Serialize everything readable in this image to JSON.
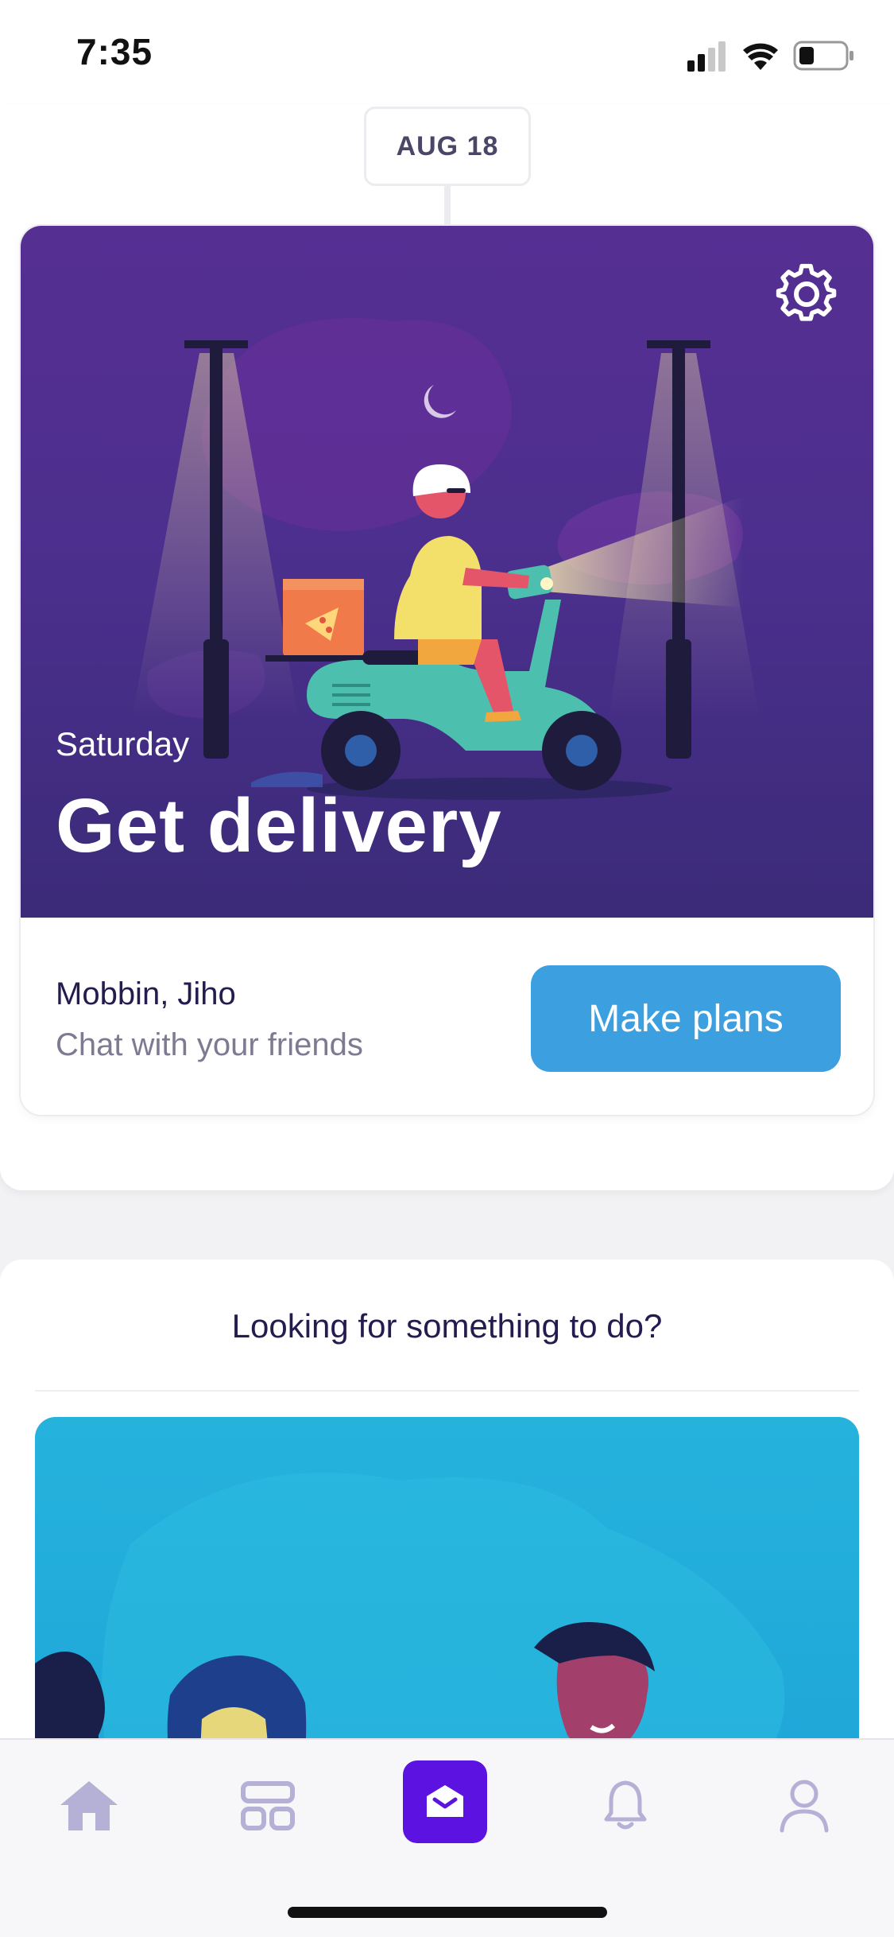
{
  "status_bar": {
    "time": "7:35"
  },
  "timeline": {
    "date": "AUG 18"
  },
  "plan_card": {
    "day": "Saturday",
    "title": "Get delivery",
    "participants": "Mobbin, Jiho",
    "subtitle": "Chat with your friends",
    "action_label": "Make plans",
    "hero_illustration": "scooter-pizza-delivery-night",
    "settings_icon": "gear-icon"
  },
  "suggestions": {
    "heading": "Looking for something to do?",
    "illustration": "friends-people-illustration"
  },
  "tab_bar": {
    "items": [
      {
        "name": "home",
        "icon": "home-icon",
        "active": false
      },
      {
        "name": "plans",
        "icon": "grid-icon",
        "active": false
      },
      {
        "name": "inbox",
        "icon": "envelope-icon",
        "active": true
      },
      {
        "name": "notifications",
        "icon": "bell-icon",
        "active": false
      },
      {
        "name": "profile",
        "icon": "person-icon",
        "active": false
      }
    ]
  },
  "colors": {
    "hero_purple": "#4b2f8d",
    "button_blue": "#3c9fe0",
    "active_tab": "#5c12e0",
    "inactive_tab": "#b5b0d6",
    "idea_card_blue": "#1ea5d8"
  }
}
